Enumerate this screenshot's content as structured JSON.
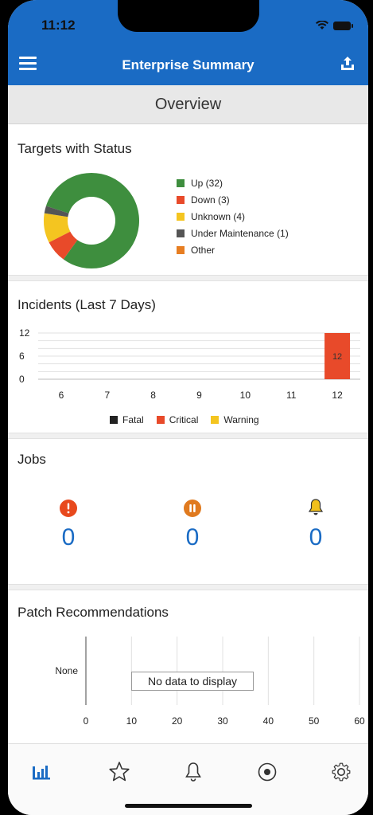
{
  "status_bar": {
    "time": "11:12"
  },
  "header": {
    "title": "Enterprise Summary"
  },
  "overview": {
    "label": "Overview"
  },
  "targets": {
    "title": "Targets with Status",
    "legend": [
      {
        "label": "Up (32)",
        "color": "#3e8e3e"
      },
      {
        "label": "Down (3)",
        "color": "#e84a2a"
      },
      {
        "label": "Unknown (4)",
        "color": "#f4c520"
      },
      {
        "label": "Under Maintenance (1)",
        "color": "#555555"
      },
      {
        "label": "Other",
        "color": "#e77e22"
      }
    ]
  },
  "incidents": {
    "title": "Incidents (Last 7 Days)",
    "legend": [
      {
        "label": "Fatal",
        "color": "#222222"
      },
      {
        "label": "Critical",
        "color": "#e84a2a"
      },
      {
        "label": "Warning",
        "color": "#f4c520"
      }
    ]
  },
  "jobs": {
    "title": "Jobs",
    "items": [
      {
        "icon": "error-icon",
        "count": "0",
        "color": "#e8491d"
      },
      {
        "icon": "pause-icon",
        "count": "0",
        "color": "#e07a1f"
      },
      {
        "icon": "bell-icon",
        "count": "0",
        "color": "#f2c01b"
      }
    ]
  },
  "patch": {
    "title": "Patch Recommendations",
    "empty_message": "No data to display"
  },
  "tabs": [
    {
      "icon": "bar-chart-icon",
      "active": true
    },
    {
      "icon": "star-icon",
      "active": false
    },
    {
      "icon": "bell-icon",
      "active": false
    },
    {
      "icon": "target-icon",
      "active": false
    },
    {
      "icon": "gear-icon",
      "active": false
    }
  ],
  "chart_data": [
    {
      "type": "pie",
      "categories": [
        "Up (32)",
        "Down (3)",
        "Unknown (4)",
        "Under Maintenance (1)",
        "Other"
      ],
      "values": [
        32,
        3,
        4,
        1,
        0
      ],
      "colors": [
        "#3e8e3e",
        "#e84a2a",
        "#f4c520",
        "#555555",
        "#e77e22"
      ],
      "title": "Targets with Status",
      "legend": "right",
      "donut": true
    },
    {
      "type": "bar",
      "categories": [
        "6",
        "7",
        "8",
        "9",
        "10",
        "11",
        "12"
      ],
      "series": [
        {
          "name": "Fatal",
          "values": [
            0,
            0,
            0,
            0,
            0,
            0,
            0
          ],
          "color": "#222222"
        },
        {
          "name": "Critical",
          "values": [
            0,
            0,
            0,
            0,
            0,
            0,
            12
          ],
          "color": "#e84a2a"
        },
        {
          "name": "Warning",
          "values": [
            0,
            0,
            0,
            0,
            0,
            0,
            0
          ],
          "color": "#f4c520"
        }
      ],
      "title": "Incidents (Last 7 Days)",
      "yticks": [
        "0",
        "6",
        "12"
      ],
      "ylim": [
        0,
        12
      ],
      "data_labels": [
        "12"
      ],
      "legend": "bottom",
      "grid": true
    },
    {
      "type": "bar",
      "orientation": "horizontal",
      "categories": [
        "None"
      ],
      "values": [],
      "title": "Patch Recommendations",
      "xticks": [
        "0",
        "10",
        "20",
        "30",
        "40",
        "50",
        "60"
      ],
      "xlim": [
        0,
        60
      ],
      "empty_message": "No data to display",
      "grid": true
    }
  ]
}
